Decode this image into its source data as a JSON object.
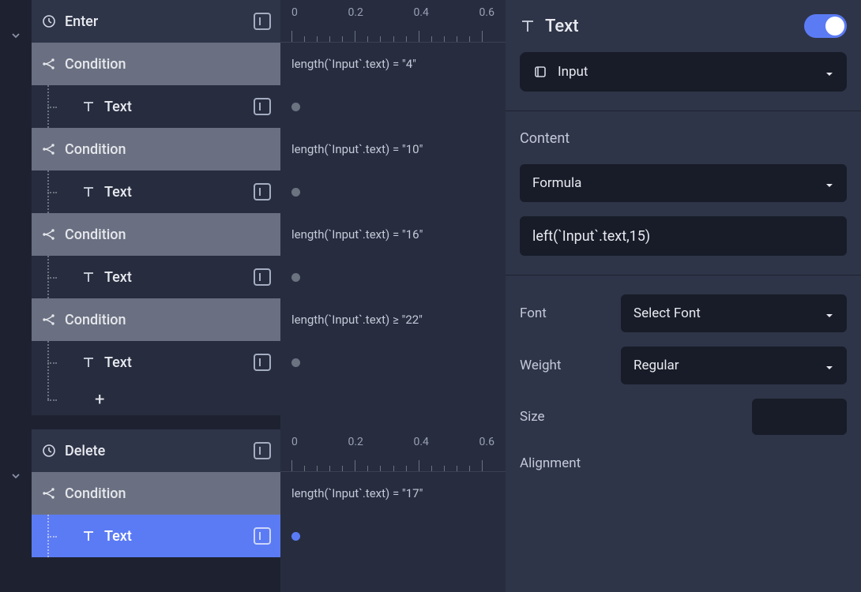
{
  "tree": {
    "section1": {
      "header": "Enter",
      "rows": [
        {
          "type": "condition",
          "label": "Condition",
          "formula": "length(`Input`.text) = \"4\""
        },
        {
          "type": "text",
          "label": "Text"
        },
        {
          "type": "condition",
          "label": "Condition",
          "formula": "length(`Input`.text) = \"10\""
        },
        {
          "type": "text",
          "label": "Text"
        },
        {
          "type": "condition",
          "label": "Condition",
          "formula": "length(`Input`.text) = \"16\""
        },
        {
          "type": "text",
          "label": "Text"
        },
        {
          "type": "condition",
          "label": "Condition",
          "formula": "length(`Input`.text) ≥ \"22\""
        },
        {
          "type": "text",
          "label": "Text"
        }
      ]
    },
    "section2": {
      "header": "Delete",
      "rows": [
        {
          "type": "condition",
          "label": "Condition",
          "formula": "length(`Input`.text) = \"17\""
        },
        {
          "type": "text",
          "label": "Text",
          "selected": true
        }
      ]
    }
  },
  "timeline": {
    "ticks": [
      "0",
      "0.2",
      "0.4",
      "0.6"
    ]
  },
  "inspector": {
    "title": "Text",
    "target": "Input",
    "content_label": "Content",
    "content_type": "Formula",
    "content_formula": "left(`Input`.text,15)",
    "font_label": "Font",
    "font_value": "Select Font",
    "weight_label": "Weight",
    "weight_value": "Regular",
    "size_label": "Size",
    "alignment_label": "Alignment"
  }
}
